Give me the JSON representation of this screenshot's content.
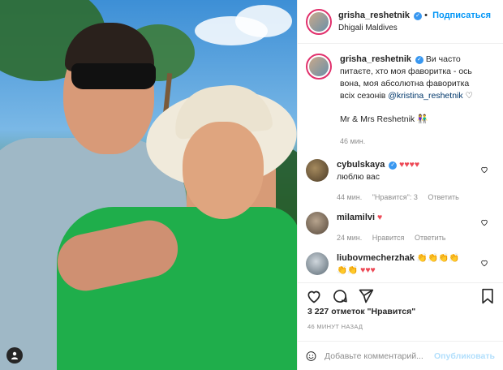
{
  "post": {
    "username": "grisha_reshetnik",
    "follow_label": "Подписаться",
    "location": "Dhigali Maldives",
    "caption_line1": "Ви часто питаєте,",
    "caption_line2": "хто моя фаворитка - ось вона, моя",
    "caption_line3": "абсолютна фаворитка всіх сезонів",
    "caption_mention": "@kristina_reshetnik",
    "caption_heart": "♡",
    "caption_extra": "Mr & Mrs Reshetnik 👫",
    "caption_time": "46 мин."
  },
  "comments": [
    {
      "username": "cybulskaya",
      "hearts": "♥♥♥♥",
      "text": "люблю вас",
      "time": "44 мин.",
      "likes": "\"Нравится\": 3",
      "reply": "Ответить"
    },
    {
      "username": "milamilvi",
      "hearts": "♥",
      "text": "",
      "time": "24 мин.",
      "likes": "Нравится",
      "reply": "Ответить"
    },
    {
      "username": "liubovmecherzhak",
      "text": "👏👏👏👏",
      "line2_claps": "👏👏",
      "line2_hearts": "♥♥♥"
    }
  ],
  "stats": {
    "likes": "3 227 отметок \"Нравится\"",
    "time_ago": "46 МИНУТ НАЗАД"
  },
  "comment_box": {
    "placeholder": "Добавьте комментарий...",
    "publish_label": "Опубликовать"
  }
}
